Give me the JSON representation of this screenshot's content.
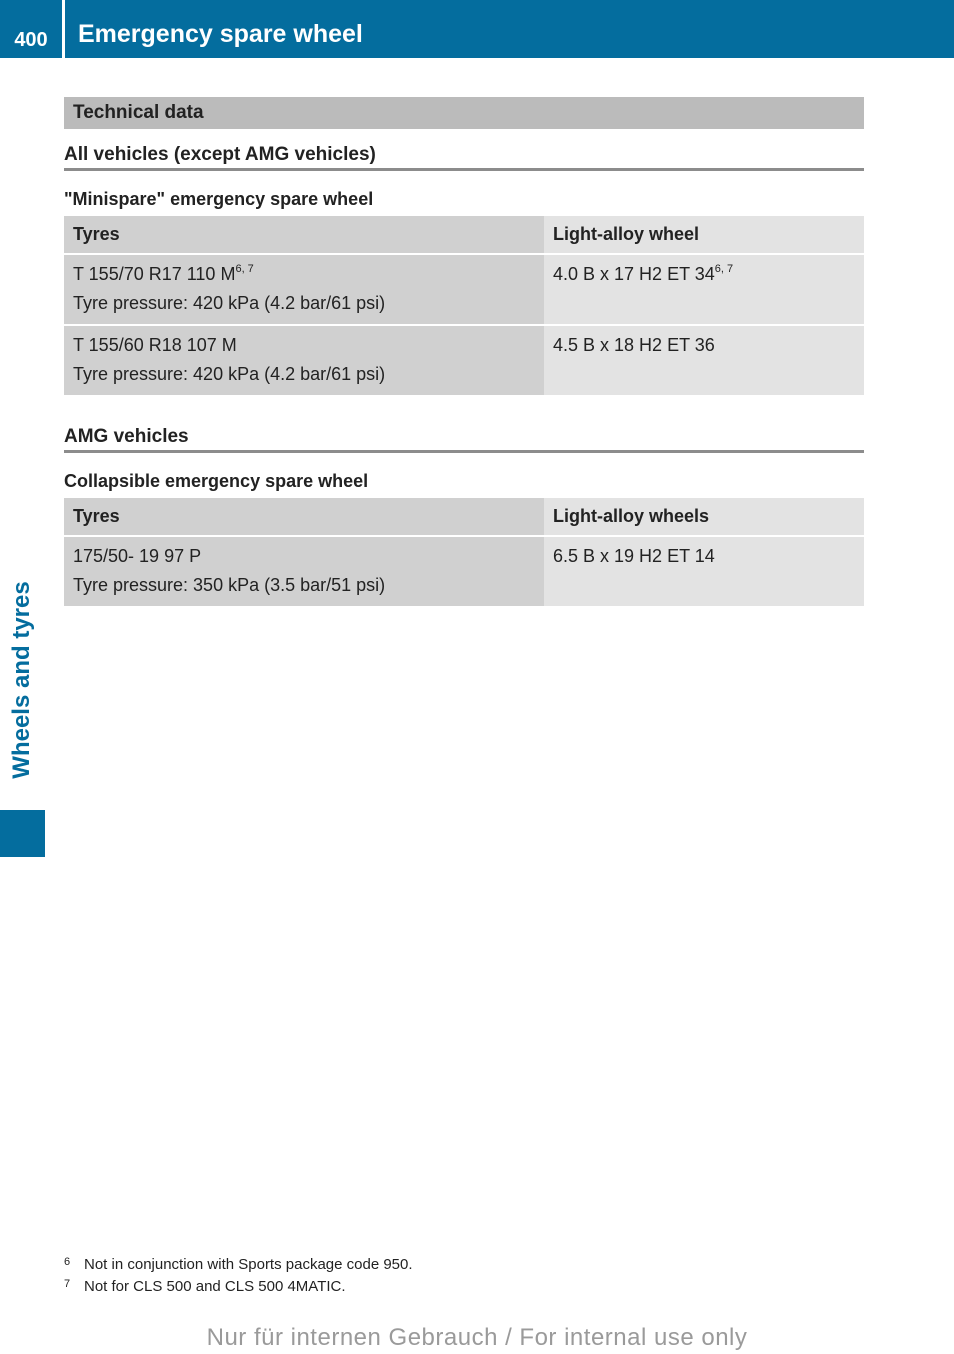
{
  "header": {
    "page_number": "400",
    "title": "Emergency spare wheel",
    "accent_color": "#046d9e"
  },
  "side_tab": {
    "label": "Wheels and tyres"
  },
  "section": {
    "title": "Technical data",
    "groups": [
      {
        "heading": "All vehicles (except AMG vehicles)",
        "table_title": "\"Minispare\" emergency spare wheel",
        "columns": [
          "Tyres",
          "Light-alloy wheel"
        ],
        "rows": [
          {
            "tyre": "T 155/70 R17 110 M",
            "tyre_sup": "6, 7",
            "pressure": "Tyre pressure: 420 kPa (4.2 bar/61 psi)",
            "wheel": "4.0 B x 17 H2 ET 34",
            "wheel_sup": "6, 7"
          },
          {
            "tyre": "T 155/60 R18 107 M",
            "tyre_sup": "",
            "pressure": "Tyre pressure: 420 kPa (4.2 bar/61 psi)",
            "wheel": "4.5 B x 18 H2 ET 36",
            "wheel_sup": ""
          }
        ]
      },
      {
        "heading": "AMG vehicles",
        "table_title": "Collapsible emergency spare wheel",
        "columns": [
          "Tyres",
          "Light-alloy wheels"
        ],
        "rows": [
          {
            "tyre": "175/50- 19 97 P",
            "tyre_sup": "",
            "pressure": "Tyre pressure: 350 kPa (3.5 bar/51 psi)",
            "wheel": "6.5 B x 19 H2 ET 14",
            "wheel_sup": ""
          }
        ]
      }
    ]
  },
  "footnotes": [
    {
      "num": "6",
      "text": "Not in conjunction with Sports package code 950."
    },
    {
      "num": "7",
      "text": "Not for CLS 500 and CLS 500 4MATIC."
    }
  ],
  "watermark": "Nur für internen Gebrauch / For internal use only"
}
